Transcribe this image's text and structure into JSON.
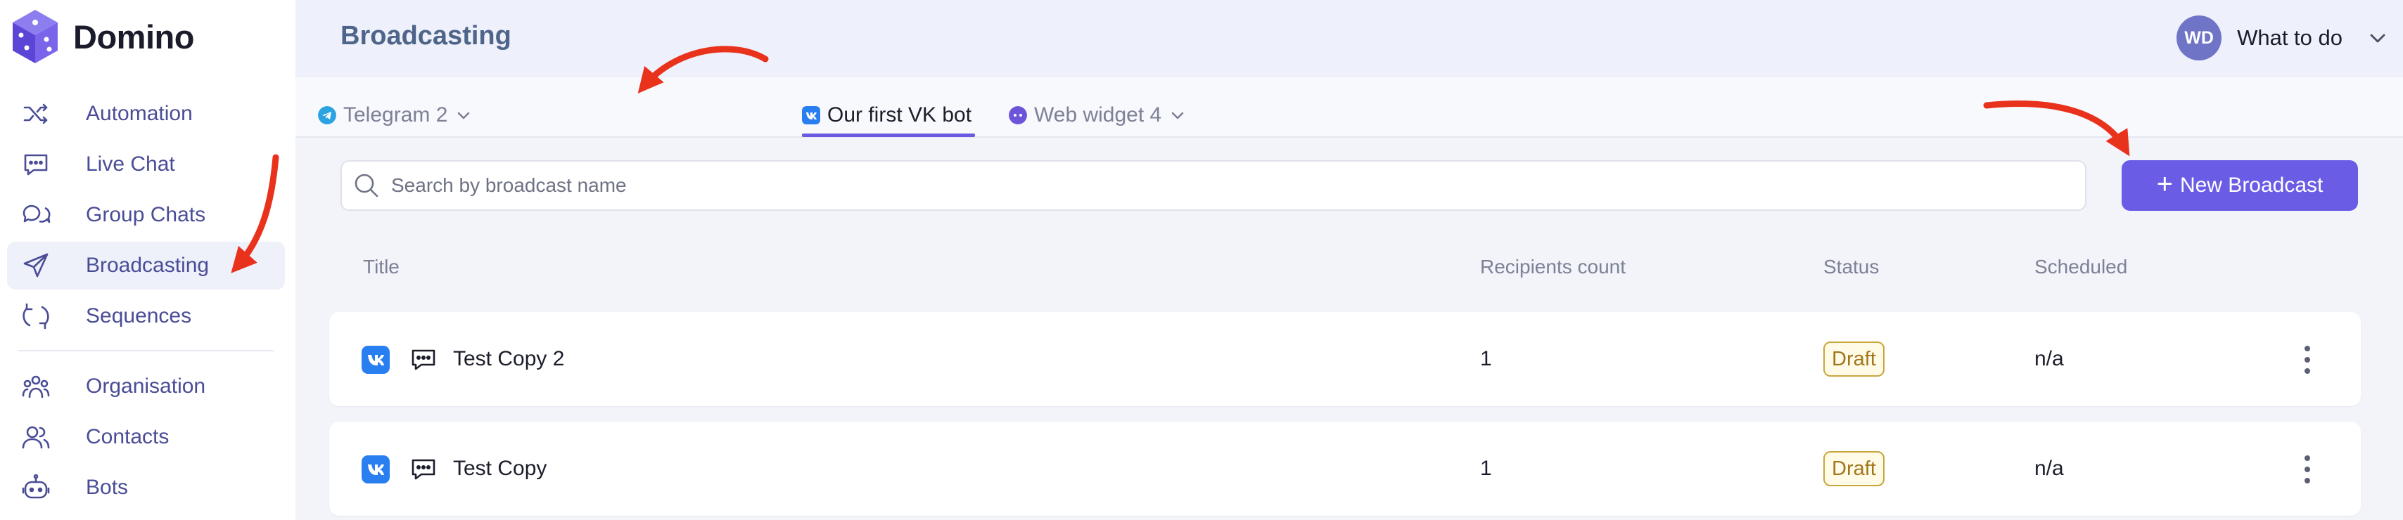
{
  "brand": {
    "name": "Domino"
  },
  "sidebar": {
    "items": [
      {
        "label": "Automation",
        "icon": "shuffle-icon"
      },
      {
        "label": "Live Chat",
        "icon": "chat-bubble-icon"
      },
      {
        "label": "Group Chats",
        "icon": "group-chat-icon"
      },
      {
        "label": "Broadcasting",
        "icon": "send-icon",
        "active": true
      },
      {
        "label": "Sequences",
        "icon": "sequence-icon"
      },
      {
        "label": "Organisation",
        "icon": "organisation-icon"
      },
      {
        "label": "Contacts",
        "icon": "contacts-icon"
      },
      {
        "label": "Bots",
        "icon": "bot-icon"
      }
    ]
  },
  "header": {
    "title": "Broadcasting",
    "user": {
      "initials": "WD",
      "name": "What to do"
    }
  },
  "tabs": [
    {
      "label": "Telegram 2",
      "icon": "telegram-icon"
    },
    {
      "label": "Our first VK bot",
      "icon": "vk-icon",
      "active": true
    },
    {
      "label": "Web widget 4",
      "icon": "web-widget-icon"
    }
  ],
  "search": {
    "placeholder": "Search by broadcast name",
    "value": ""
  },
  "actions": {
    "new_broadcast": "New Broadcast"
  },
  "table": {
    "columns": {
      "title": "Title",
      "recipients": "Recipients count",
      "status": "Status",
      "scheduled": "Scheduled"
    },
    "rows": [
      {
        "title": "Test Copy 2",
        "recipients": "1",
        "status": "Draft",
        "scheduled": "n/a"
      },
      {
        "title": "Test Copy",
        "recipients": "1",
        "status": "Draft",
        "scheduled": "n/a"
      }
    ]
  },
  "colors": {
    "accent": "#6a5ce4",
    "annotation_arrow": "#e8321c",
    "draft_border": "#c9a63c",
    "vk_blue": "#2a7ff0"
  }
}
